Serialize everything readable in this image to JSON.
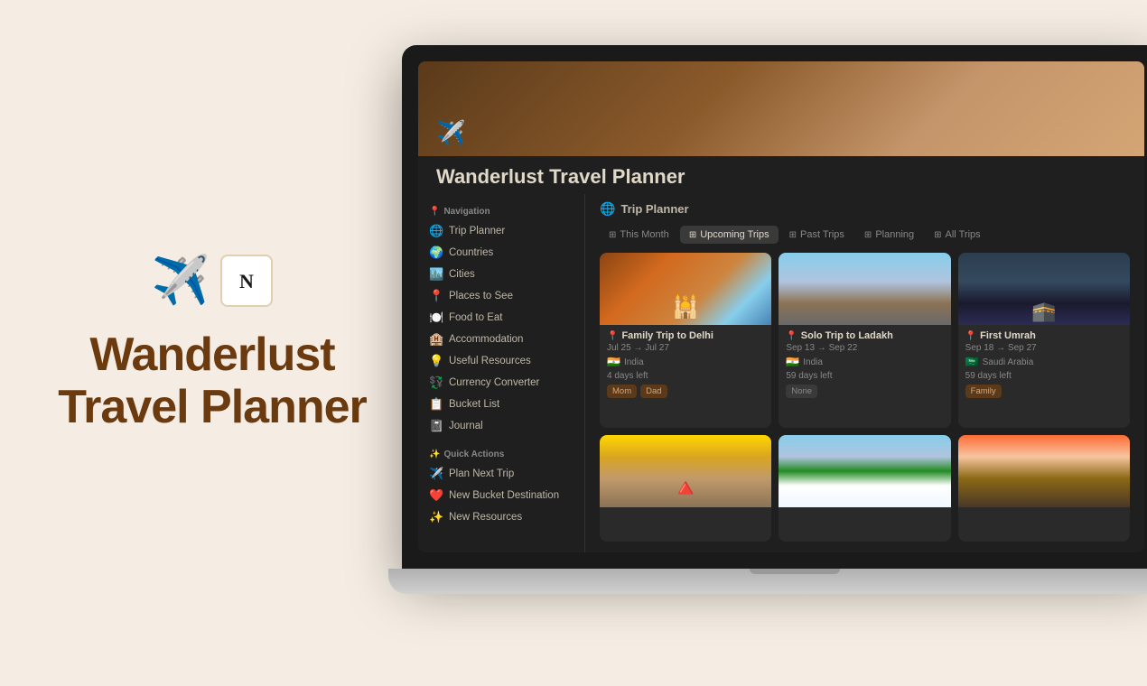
{
  "background_color": "#f5ede3",
  "left_panel": {
    "plane_emoji": "✈️",
    "notion_emoji": "N",
    "title_line1": "Wanderlust",
    "title_line2": "Travel Planner"
  },
  "screen": {
    "page_icon": "✈️",
    "page_title": "Wanderlust Travel Planner",
    "sidebar": {
      "nav_label": "Navigation",
      "nav_icon": "📍",
      "items": [
        {
          "icon": "🌐",
          "label": "Trip Planner"
        },
        {
          "icon": "🌍",
          "label": "Countries"
        },
        {
          "icon": "🏙️",
          "label": "Cities"
        },
        {
          "icon": "📍",
          "label": "Places to See"
        },
        {
          "icon": "🍽️",
          "label": "Food to Eat"
        },
        {
          "icon": "🏨",
          "label": "Accommodation"
        },
        {
          "icon": "💡",
          "label": "Useful Resources"
        },
        {
          "icon": "💱",
          "label": "Currency Converter"
        },
        {
          "icon": "📋",
          "label": "Bucket List"
        },
        {
          "icon": "📓",
          "label": "Journal"
        }
      ],
      "quick_actions_label": "Quick Actions",
      "quick_actions_icon": "✨",
      "quick_actions": [
        {
          "icon": "✈️",
          "label": "Plan Next Trip"
        },
        {
          "icon": "❤️",
          "label": "New Bucket Destination"
        },
        {
          "icon": "✨",
          "label": "New Resources"
        }
      ]
    },
    "main": {
      "section_icon": "🌐",
      "section_title": "Trip Planner",
      "tabs": [
        {
          "icon": "⊞",
          "label": "This Month",
          "active": false
        },
        {
          "icon": "⊞",
          "label": "Upcoming Trips",
          "active": true
        },
        {
          "icon": "⊞",
          "label": "Past Trips",
          "active": false
        },
        {
          "icon": "⊞",
          "label": "Planning",
          "active": false
        },
        {
          "icon": "⊞",
          "label": "All Trips",
          "active": false
        }
      ],
      "cards": [
        {
          "id": "delhi",
          "img_class": "img-delhi",
          "pin": "📍",
          "title": "Family Trip to Delhi",
          "date": "Jul 25 → Jul 27",
          "flag": "🇮🇳",
          "country": "India",
          "days": "4 days left",
          "tags": [
            {
              "label": "Mom",
              "class": "tag-brown"
            },
            {
              "label": "Dad",
              "class": "tag-brown"
            }
          ]
        },
        {
          "id": "ladakh",
          "img_class": "img-ladakh",
          "pin": "📍",
          "title": "Solo Trip to Ladakh",
          "date": "Sep 13 → Sep 22",
          "flag": "🇮🇳",
          "country": "India",
          "days": "59 days left",
          "tags": [
            {
              "label": "None",
              "class": "tag-gray"
            }
          ]
        },
        {
          "id": "umrah",
          "img_class": "img-umrah",
          "pin": "📍",
          "title": "First Umrah",
          "date": "Sep 18 → Sep 27",
          "flag": "🇸🇦",
          "country": "Saudi Arabia",
          "days": "59 days left",
          "tags": [
            {
              "label": "Family",
              "class": "tag-orange"
            }
          ]
        },
        {
          "id": "pyramids",
          "img_class": "img-pyramids",
          "pin": "",
          "title": "",
          "date": "",
          "flag": "",
          "country": "",
          "days": "",
          "tags": []
        },
        {
          "id": "snow-forest",
          "img_class": "img-snow-forest",
          "pin": "",
          "title": "",
          "date": "",
          "flag": "",
          "country": "",
          "days": "",
          "tags": []
        },
        {
          "id": "mosque",
          "img_class": "img-mosque",
          "pin": "",
          "title": "",
          "date": "",
          "flag": "",
          "country": "",
          "days": "",
          "tags": []
        }
      ]
    }
  }
}
